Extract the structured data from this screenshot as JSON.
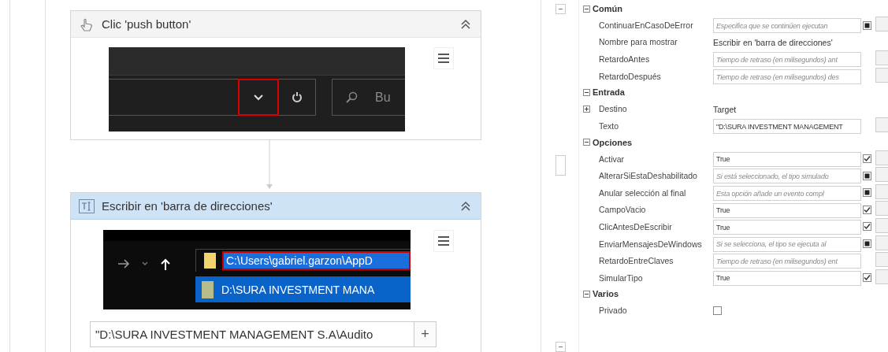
{
  "flow": {
    "steps": [
      {
        "kind": "click",
        "title": "Clic 'push button'",
        "selected": false,
        "preview": {
          "kind": "toolbar",
          "search_text": "Bu"
        }
      },
      {
        "kind": "type",
        "title": "Escribir en 'barra de direcciones'",
        "selected": true,
        "preview": {
          "kind": "address",
          "path": "C:\\Users\\gabriel.garzon\\AppD",
          "suggestion": "D:\\SURA INVESTMENT MANA"
        },
        "input": {
          "value": "\"D:\\SURA INVESTMENT MANAGEMENT S.A\\Audito",
          "button": "+"
        }
      }
    ]
  },
  "properties": {
    "categories": [
      {
        "title": "Común",
        "expanded": true,
        "rows": [
          {
            "name": "ContinuarEnCasoDeError",
            "kind": "field",
            "placeholder": "Especifica que se continúen ejecutan",
            "checkbox": {
              "checked": false,
              "indeterminate": true
            }
          },
          {
            "name": "Nombre para mostrar",
            "kind": "text",
            "value": "Escribir en 'barra de direcciones'"
          },
          {
            "name": "RetardoAntes",
            "kind": "field",
            "placeholder": "Tiempo de retraso (en milisegundos) ant"
          },
          {
            "name": "RetardoDespués",
            "kind": "field",
            "placeholder": "Tiempo de retraso (en milisegundos) des"
          }
        ]
      },
      {
        "title": "Entrada",
        "expanded": true,
        "rows": [
          {
            "name": "Destino",
            "kind": "text",
            "value": "Target",
            "expanded": false
          },
          {
            "name": "Texto",
            "kind": "field",
            "value": "\"D:\\SURA INVESTMENT MANAGEMENT"
          }
        ]
      },
      {
        "title": "Opciones",
        "expanded": true,
        "rows": [
          {
            "name": "Activar",
            "kind": "field",
            "value": "True",
            "checkbox": {
              "checked": true,
              "indeterminate": false
            }
          },
          {
            "name": "AlterarSiEstaDeshabilitado",
            "kind": "field",
            "placeholder": "Si está seleccionado, el tipo simulado",
            "checkbox": {
              "checked": false,
              "indeterminate": true
            }
          },
          {
            "name": "Anular selección al final",
            "kind": "field",
            "placeholder": "Esta opción añade un evento compl",
            "checkbox": {
              "checked": false,
              "indeterminate": true
            }
          },
          {
            "name": "CampoVacio",
            "kind": "field",
            "value": "True",
            "checkbox": {
              "checked": true,
              "indeterminate": false
            }
          },
          {
            "name": "ClicAntesDeEscribir",
            "kind": "field",
            "value": "True",
            "checkbox": {
              "checked": true,
              "indeterminate": false
            }
          },
          {
            "name": "EnviarMensajesDeWindows",
            "kind": "field",
            "placeholder": "Si se selecciona, el tipo se ejecuta al",
            "checkbox": {
              "checked": false,
              "indeterminate": true
            }
          },
          {
            "name": "RetardoEntreClaves",
            "kind": "field",
            "placeholder": "Tiempo de retraso (en milisegundos) ent"
          },
          {
            "name": "SimularTipo",
            "kind": "field",
            "value": "True",
            "checkbox": {
              "checked": true,
              "indeterminate": false
            }
          }
        ]
      },
      {
        "title": "Varios",
        "expanded": true,
        "rows": [
          {
            "name": "Privado",
            "kind": "checkbox",
            "checked": false
          }
        ]
      }
    ]
  }
}
